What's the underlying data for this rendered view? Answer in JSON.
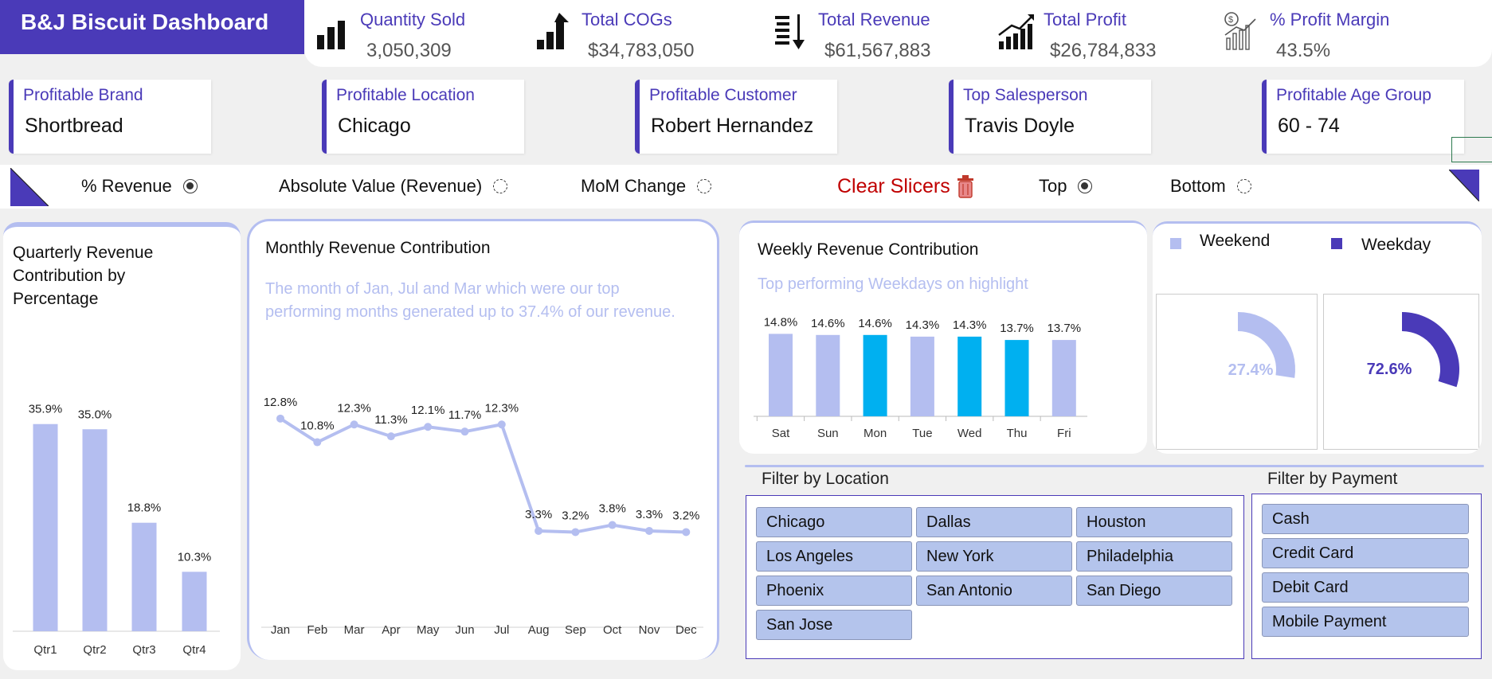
{
  "header": {
    "title": "B&J Biscuit Dashboard"
  },
  "kpis": [
    {
      "label": "Quantity Sold",
      "value": "3,050,309",
      "icon": "bar-chart-icon"
    },
    {
      "label": "Total COGs",
      "value": "$34,783,050",
      "icon": "growth-arrow-icon"
    },
    {
      "label": "Total Revenue",
      "value": "$61,567,883",
      "icon": "coins-down-icon"
    },
    {
      "label": "Total Profit",
      "value": "$26,784,833",
      "icon": "trend-up-icon"
    },
    {
      "label": "% Profit Margin",
      "value": "43.5%",
      "icon": "profit-chart-icon"
    }
  ],
  "cards": [
    {
      "label": "Profitable Brand",
      "value": "Shortbread"
    },
    {
      "label": "Profitable Location",
      "value": "Chicago"
    },
    {
      "label": "Profitable Customer",
      "value": "Robert Hernandez"
    },
    {
      "label": "Top Salesperson",
      "value": "Travis Doyle"
    },
    {
      "label": "Profitable Age Group",
      "value": "60 - 74"
    }
  ],
  "slicers": {
    "revenue_pct": "% Revenue",
    "absolute": "Absolute Value (Revenue)",
    "mom": "MoM Change",
    "clear": "Clear Slicers",
    "top": "Top",
    "bottom": "Bottom",
    "selected": [
      "% Revenue",
      "Top"
    ]
  },
  "quarterly": {
    "title": "Quarterly Revenue Contribution by Percentage"
  },
  "monthly": {
    "title": "Monthly Revenue Contribution",
    "subtitle": "The month of Jan, Jul and Mar which were our top performing months generated up to 37.4% of our revenue."
  },
  "weekly": {
    "title": "Weekly Revenue Contribution",
    "subtitle": "Top performing Weekdays on highlight"
  },
  "split": {
    "weekend_label": "Weekend",
    "weekday_label": "Weekday"
  },
  "filters": {
    "location_title": "Filter by Location",
    "payment_title": "Filter by Payment",
    "locations": [
      "Chicago",
      "Dallas",
      "Houston",
      "Los Angeles",
      "New York",
      "Philadelphia",
      "Phoenix",
      "San Antonio",
      "San Diego",
      "San Jose"
    ],
    "payments": [
      "Cash",
      "Credit Card",
      "Debit Card",
      "Mobile Payment"
    ]
  },
  "colors": {
    "accent": "#4a3ab8",
    "light": "#b4bef0",
    "highlight": "#00b0f0",
    "clear": "#c00000"
  },
  "chart_data": [
    {
      "type": "bar",
      "categories": [
        "Qtr1",
        "Qtr2",
        "Qtr3",
        "Qtr4"
      ],
      "values": [
        35.9,
        35.0,
        18.8,
        10.3
      ],
      "labels": [
        "35.9%",
        "35.0%",
        "18.8%",
        "10.3%"
      ],
      "ylim": [
        0,
        40
      ]
    },
    {
      "type": "line",
      "categories": [
        "Jan",
        "Feb",
        "Mar",
        "Apr",
        "May",
        "Jun",
        "Jul",
        "Aug",
        "Sep",
        "Oct",
        "Nov",
        "Dec"
      ],
      "values": [
        12.8,
        10.8,
        12.3,
        11.3,
        12.1,
        11.7,
        12.3,
        3.3,
        3.2,
        3.8,
        3.3,
        3.2
      ],
      "labels": [
        "12.8%",
        "10.8%",
        "12.3%",
        "11.3%",
        "12.1%",
        "11.7%",
        "12.3%",
        "3.3%",
        "3.2%",
        "3.8%",
        "3.3%",
        "3.2%"
      ],
      "ylim": [
        0,
        14
      ]
    },
    {
      "type": "bar",
      "categories": [
        "Sat",
        "Sun",
        "Mon",
        "Tue",
        "Wed",
        "Thu",
        "Fri"
      ],
      "values": [
        14.8,
        14.6,
        14.6,
        14.3,
        14.3,
        13.7,
        13.7
      ],
      "labels": [
        "14.8%",
        "14.6%",
        "14.6%",
        "14.3%",
        "14.3%",
        "13.7%",
        "13.7%"
      ],
      "highlighted": [
        "Mon",
        "Wed",
        "Thu"
      ],
      "ylim": [
        0,
        16
      ]
    },
    {
      "type": "pie",
      "categories": [
        "Weekend",
        "Weekday"
      ],
      "values": [
        27.4,
        72.6
      ],
      "labels": [
        "27.4%",
        "72.6%"
      ]
    }
  ]
}
